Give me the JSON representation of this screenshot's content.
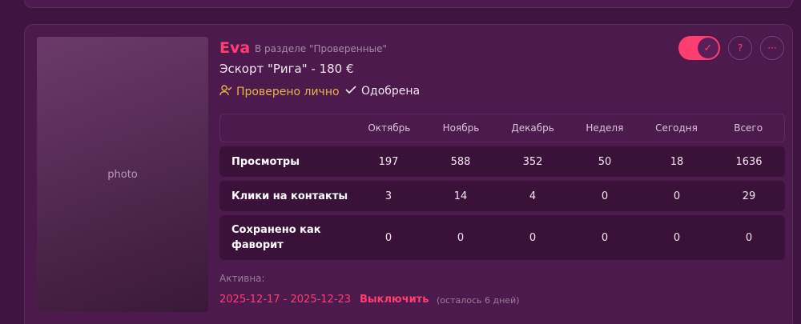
{
  "listing": {
    "name": "Eva",
    "section": "В разделе \"Проверенные\"",
    "subtitle": "Эскорт \"Рига\" - 180 €",
    "verified_label": "Проверено лично",
    "approved_label": "Одобрена",
    "help_label": "?",
    "more_label": "···"
  },
  "stats": {
    "columns": [
      "Октябрь",
      "Ноябрь",
      "Декабрь",
      "Неделя",
      "Сегодня",
      "Всего"
    ],
    "rows": [
      {
        "label": "Просмотры",
        "values": [
          "197",
          "588",
          "352",
          "50",
          "18",
          "1636"
        ]
      },
      {
        "label": "Клики на контакты",
        "values": [
          "3",
          "14",
          "4",
          "0",
          "0",
          "29"
        ]
      },
      {
        "label": "Сохранено как фаворит",
        "values": [
          "0",
          "0",
          "0",
          "0",
          "0",
          "0"
        ]
      }
    ]
  },
  "activity": {
    "label": "Активна:",
    "dates": "2025-12-17 - 2025-12-23",
    "disable_label": "Выключить",
    "remaining": "(осталось 6 дней)"
  },
  "colors": {
    "accent": "#ff3d71",
    "verified": "#e8b34b",
    "card": "#4d1a4e",
    "row": "#3a1239"
  }
}
